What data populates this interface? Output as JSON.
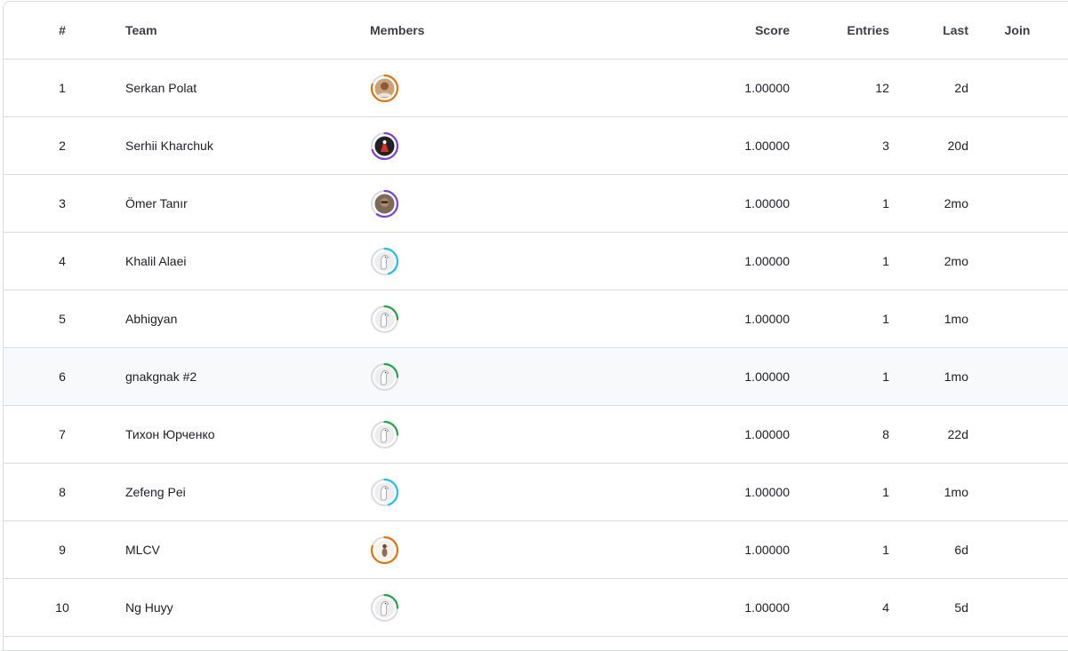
{
  "table": {
    "headers": {
      "rank": "#",
      "team": "Team",
      "members": "Members",
      "score": "Score",
      "entries": "Entries",
      "last": "Last",
      "join": "Join"
    },
    "rows": [
      {
        "rank": "1",
        "team": "Serkan Polat",
        "score": "1.00000",
        "entries": "12",
        "last": "2d",
        "avatar": "photo-portrait",
        "ring_color": "#e8710a",
        "ring_fraction": 0.8
      },
      {
        "rank": "2",
        "team": "Serhii Kharchuk",
        "score": "1.00000",
        "entries": "3",
        "last": "20d",
        "avatar": "red-figure-dark",
        "ring_color": "#7b3fe4",
        "ring_fraction": 0.7
      },
      {
        "rank": "3",
        "team": "Ömer Tanır",
        "score": "1.00000",
        "entries": "1",
        "last": "2mo",
        "avatar": "photo-sunglasses",
        "ring_color": "#7b3fe4",
        "ring_fraction": 0.6
      },
      {
        "rank": "4",
        "team": "Khalil Alaei",
        "score": "1.00000",
        "entries": "1",
        "last": "2mo",
        "avatar": "default-goose",
        "ring_color": "#20beff",
        "ring_fraction": 0.45
      },
      {
        "rank": "5",
        "team": "Abhigyan",
        "score": "1.00000",
        "entries": "1",
        "last": "1mo",
        "avatar": "default-goose",
        "ring_color": "#20a645",
        "ring_fraction": 0.25
      },
      {
        "rank": "6",
        "team": "gnakgnak #2",
        "score": "1.00000",
        "entries": "1",
        "last": "1mo",
        "avatar": "default-goose",
        "ring_color": "#20a645",
        "ring_fraction": 0.25,
        "highlight": true
      },
      {
        "rank": "7",
        "team": "Тихон Юрченко",
        "score": "1.00000",
        "entries": "8",
        "last": "22d",
        "avatar": "default-goose",
        "ring_color": "#20a645",
        "ring_fraction": 0.25
      },
      {
        "rank": "8",
        "team": "Zefeng Pei",
        "score": "1.00000",
        "entries": "1",
        "last": "1mo",
        "avatar": "default-goose",
        "ring_color": "#20beff",
        "ring_fraction": 0.45
      },
      {
        "rank": "9",
        "team": "MLCV",
        "score": "1.00000",
        "entries": "1",
        "last": "6d",
        "avatar": "duck-figure",
        "ring_color": "#e8710a",
        "ring_fraction": 0.8
      },
      {
        "rank": "10",
        "team": "Ng Huyy",
        "score": "1.00000",
        "entries": "4",
        "last": "5d",
        "avatar": "default-goose",
        "ring_color": "#20a645",
        "ring_fraction": 0.25
      }
    ]
  }
}
